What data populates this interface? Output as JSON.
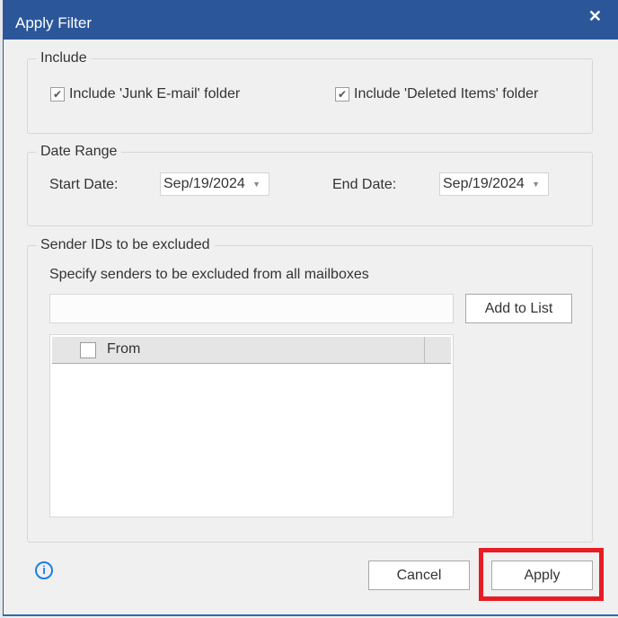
{
  "dialog": {
    "title": "Apply Filter",
    "close_icon": "close-icon"
  },
  "include": {
    "legend": "Include",
    "junk": {
      "label": "Include 'Junk E-mail' folder",
      "checked": true
    },
    "deleted": {
      "label": "Include 'Deleted Items' folder",
      "checked": true
    },
    "check_glyph": "✔"
  },
  "date_range": {
    "legend": "Date Range",
    "start_label": "Start Date:",
    "start_value": "Sep/19/2024",
    "end_label": "End Date:",
    "end_value": "Sep/19/2024",
    "arrow": "▼"
  },
  "senders": {
    "legend": "Sender IDs to be excluded",
    "instruction": "Specify senders to be excluded from all mailboxes",
    "input_value": "",
    "add_button": "Add to List",
    "table": {
      "columns": [
        "From"
      ],
      "rows": []
    }
  },
  "footer": {
    "info_glyph": "i",
    "cancel": "Cancel",
    "apply": "Apply"
  },
  "annotation": {
    "highlight_color": "#e81c24",
    "target": "apply-button"
  }
}
